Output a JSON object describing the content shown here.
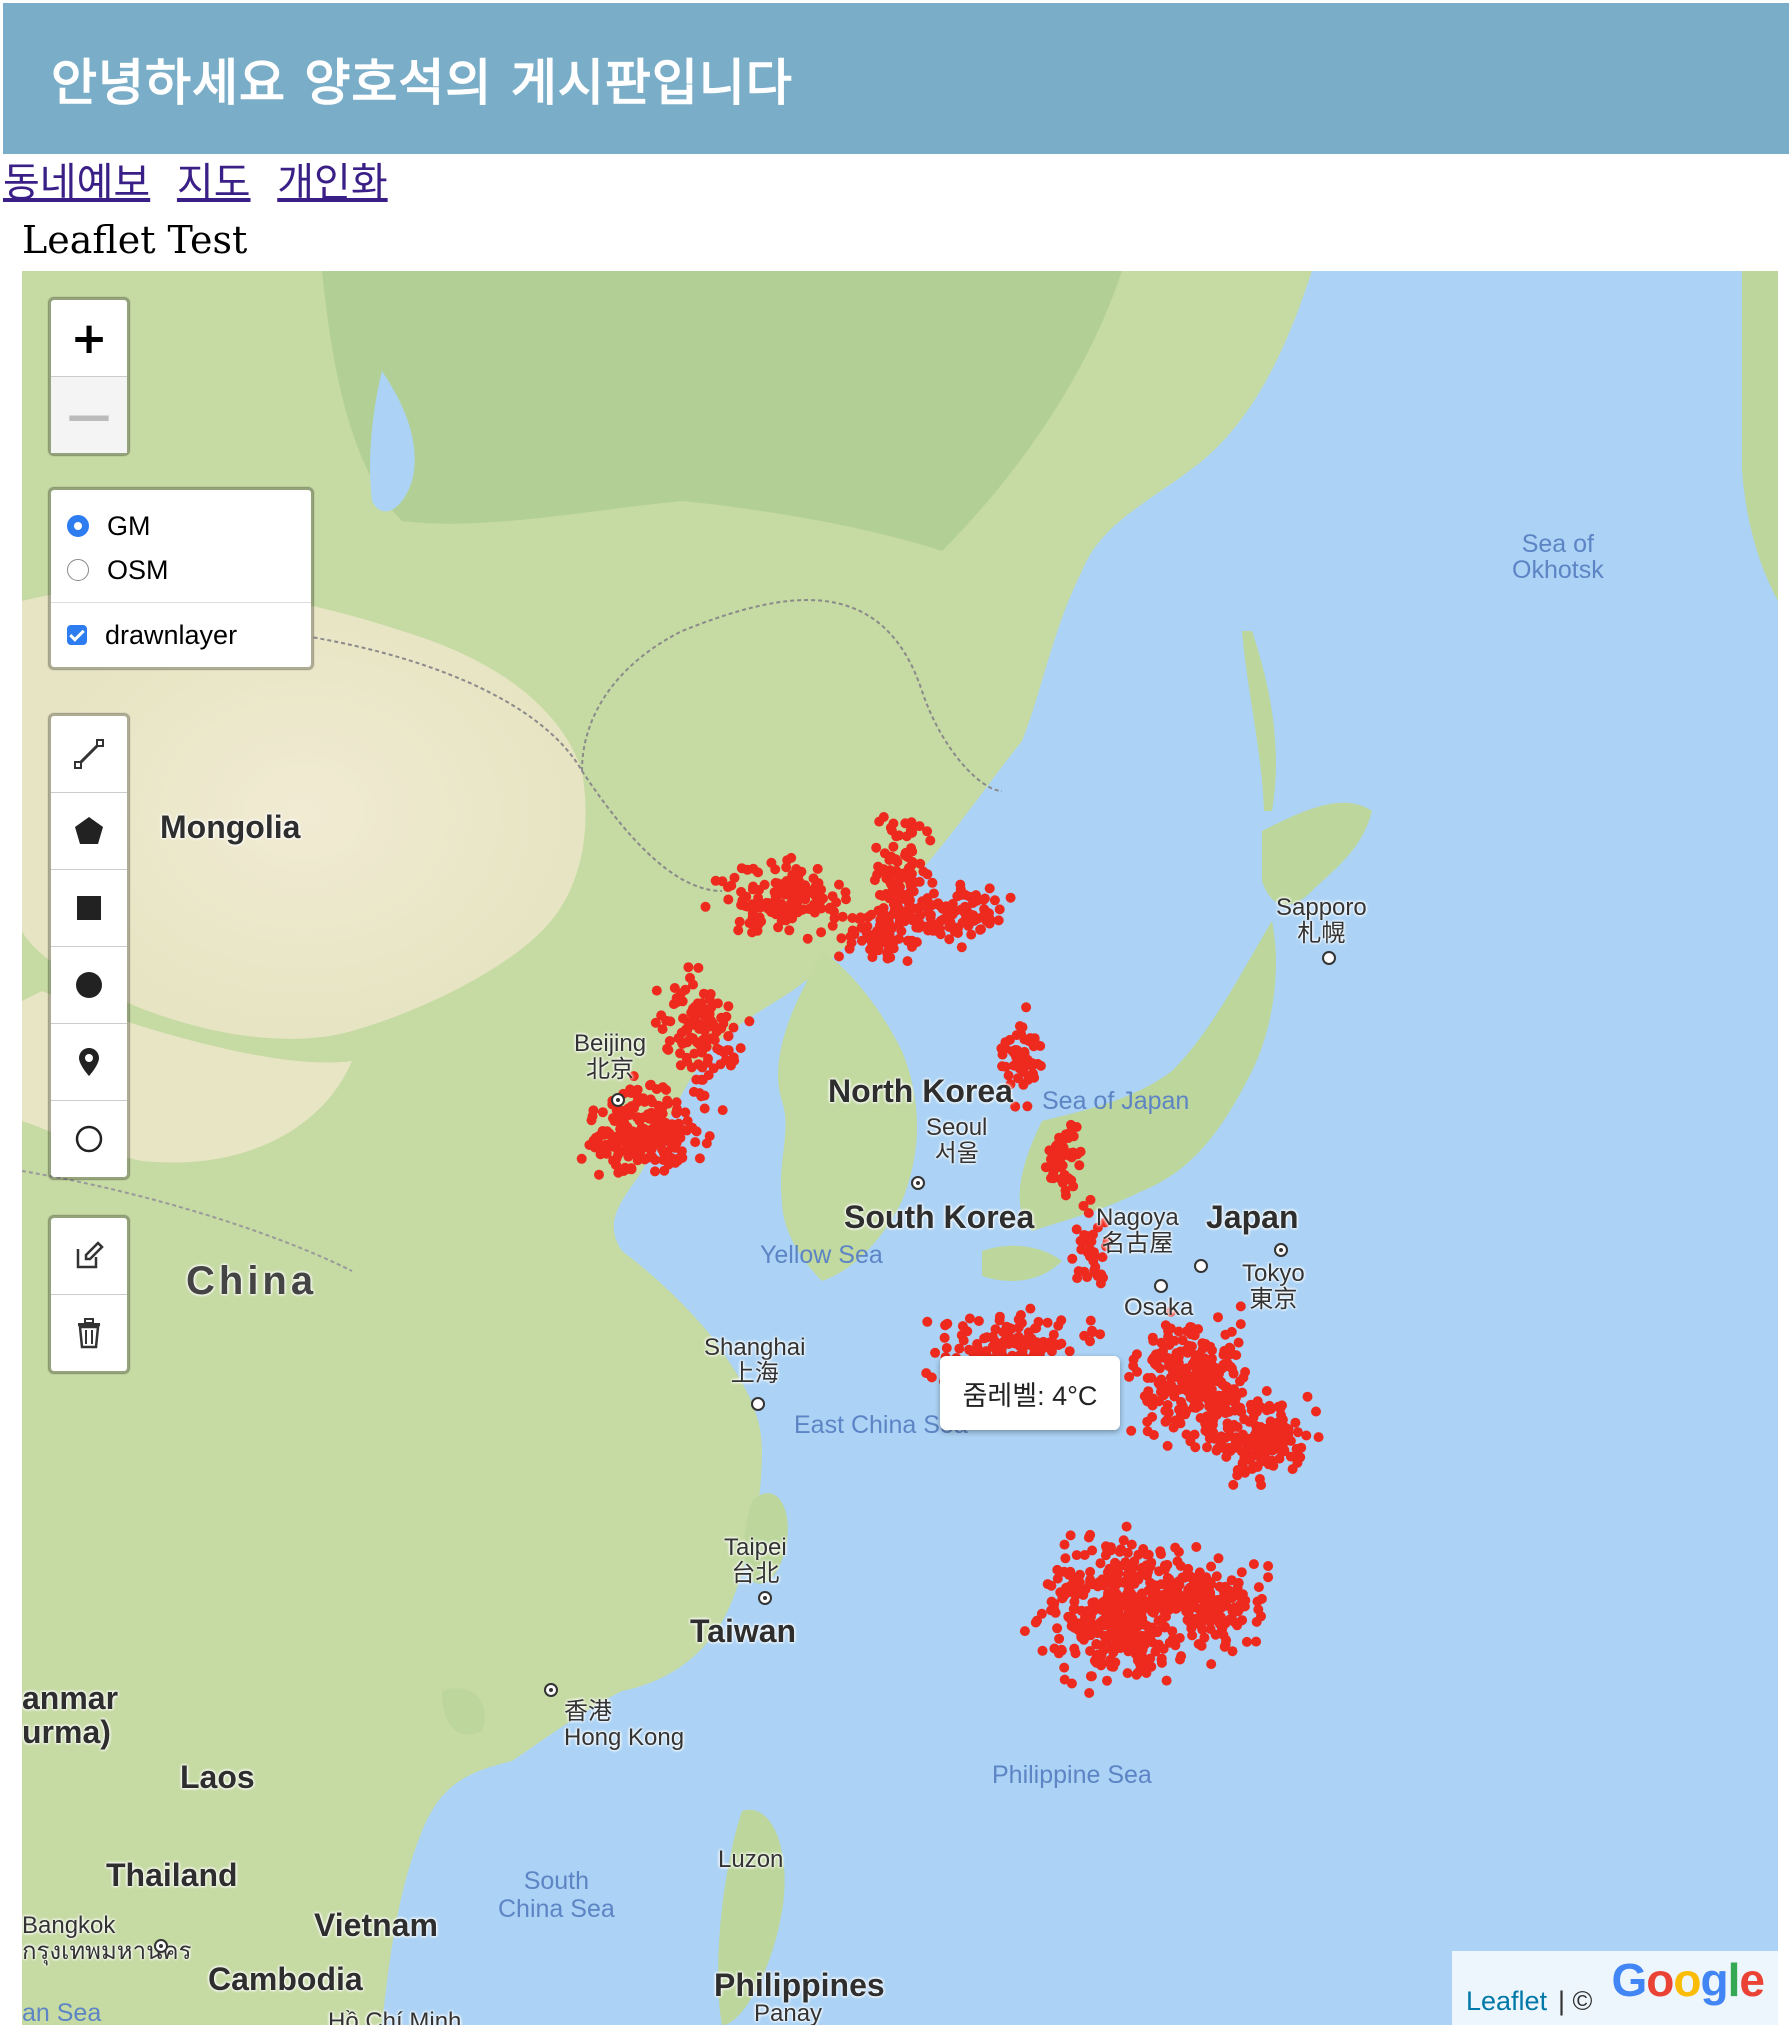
{
  "header": {
    "title": "안녕하세요 양호석의 게시판입니다"
  },
  "nav": {
    "links": [
      "동네예보",
      "지도",
      "개인화"
    ]
  },
  "page": {
    "heading": "Leaflet Test"
  },
  "map": {
    "zoom": {
      "in": "+",
      "out": "—"
    },
    "layers": {
      "base": [
        {
          "label": "GM",
          "selected": true
        },
        {
          "label": "OSM",
          "selected": false
        }
      ],
      "overlays": [
        {
          "label": "drawnlayer",
          "checked": true
        }
      ]
    },
    "draw_tools": [
      "polyline-icon",
      "polygon-icon",
      "rectangle-icon",
      "circle-icon",
      "marker-icon",
      "circlemarker-icon"
    ],
    "edit_tools": [
      "edit-icon",
      "trash-icon"
    ],
    "tooltip": "줌레벨: 4°C",
    "labels": {
      "sea_okhotsk": "Sea of\nOkhotsk",
      "mongolia": "Mongolia",
      "sapporo": "Sapporo\n札幌",
      "beijing": "Beijing\n北京",
      "north_korea": "North Korea",
      "sea_japan": "Sea of Japan",
      "seoul": "Seoul\n서울",
      "south_korea": "South Korea",
      "nagoya": "Nagoya\n名古屋",
      "japan": "Japan",
      "tokyo": "Tokyo\n東京",
      "osaka": "Osaka",
      "yellow_sea": "Yellow Sea",
      "china": "China",
      "shanghai": "Shanghai\n上海",
      "east_china_sea": "East China Sea",
      "taipei": "Taipei\n台北",
      "taiwan": "Taiwan",
      "myanmar": "anmar\nurma)",
      "hong_kong": "香港\nHong Kong",
      "laos": "Laos",
      "philippine_sea": "Philippine Sea",
      "thailand": "Thailand",
      "south_china_sea": "South\nChina Sea",
      "luzon": "Luzon",
      "bangkok": "Bangkok\nกรุงเทพมหานคร",
      "vietnam": "Vietnam",
      "cambodia": "Cambodia",
      "philippines": "Philippines",
      "panay": "Panay",
      "andaman": "an Sea",
      "hcmc": "Hồ Chí Minh"
    },
    "attribution": {
      "leaflet": "Leaflet",
      "sep": "| ©",
      "provider": "Google"
    },
    "colors": {
      "points": "#ee2a1e",
      "land": "#c9dca8",
      "water": "#acd3f5"
    }
  }
}
